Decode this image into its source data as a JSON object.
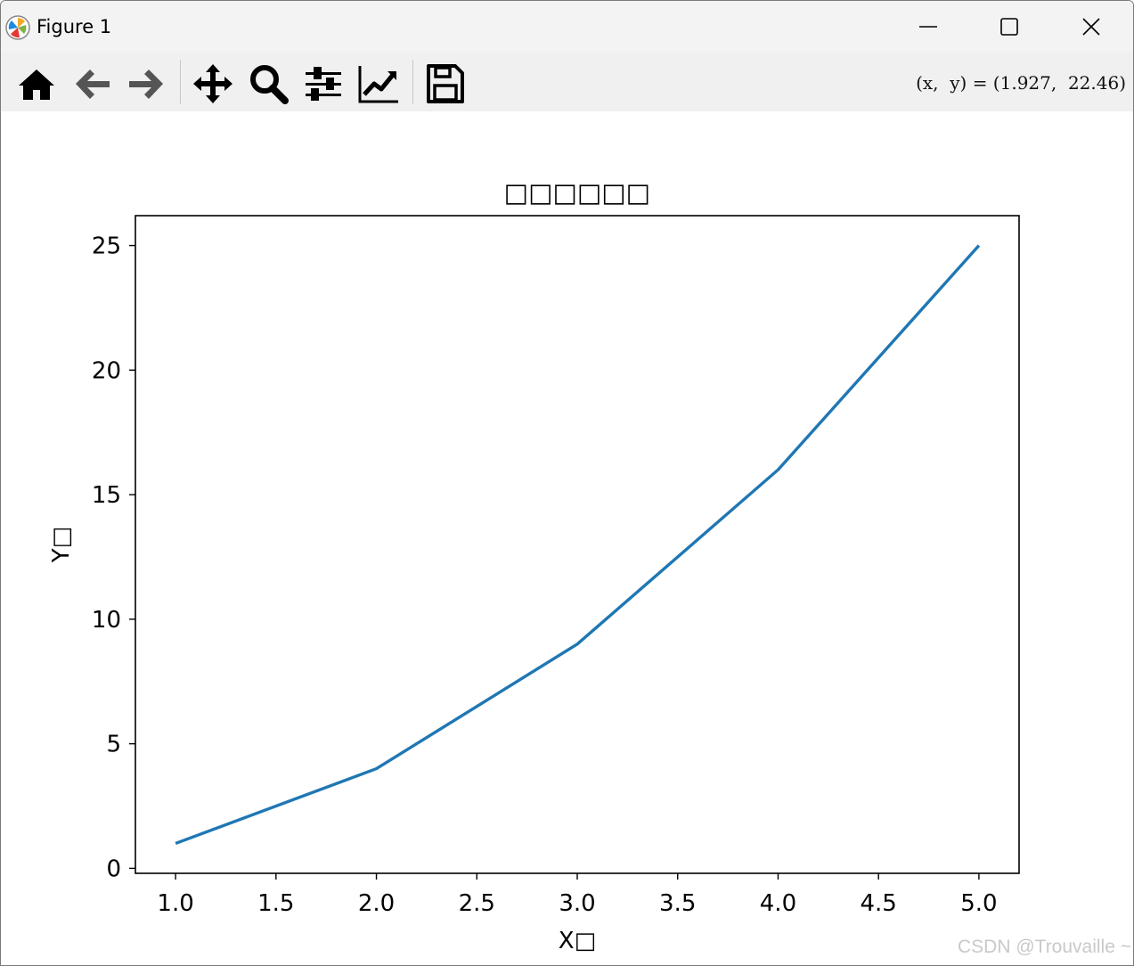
{
  "window": {
    "title": "Figure 1",
    "controls": {
      "minimize": "minimize",
      "maximize": "maximize",
      "close": "close"
    }
  },
  "toolbar": {
    "buttons": [
      {
        "id": "home",
        "icon": "home-icon",
        "label": "Home"
      },
      {
        "id": "back",
        "icon": "arrow-left-icon",
        "label": "Back"
      },
      {
        "id": "forward",
        "icon": "arrow-right-icon",
        "label": "Forward"
      },
      {
        "id": "pan",
        "icon": "move-icon",
        "label": "Pan"
      },
      {
        "id": "zoom",
        "icon": "magnifier-icon",
        "label": "Zoom"
      },
      {
        "id": "subplots",
        "icon": "sliders-icon",
        "label": "Subplots"
      },
      {
        "id": "customize",
        "icon": "line-chart-icon",
        "label": "Customize"
      },
      {
        "id": "save",
        "icon": "floppy-disk-icon",
        "label": "Save"
      }
    ],
    "coordinates": "(x,  y) = (1.927,  22.46)"
  },
  "chart_data": {
    "type": "line",
    "title": "□□□□□□",
    "xlabel": "X□",
    "ylabel": "Y□",
    "x": [
      1,
      2,
      3,
      4,
      5
    ],
    "series": [
      {
        "values": [
          1,
          4,
          9,
          16,
          25
        ],
        "color": "#1f77b4"
      }
    ],
    "xlim": [
      0.8,
      5.2
    ],
    "ylim": [
      -0.2,
      26.2
    ],
    "xticks": [
      1.0,
      1.5,
      2.0,
      2.5,
      3.0,
      3.5,
      4.0,
      4.5,
      5.0
    ],
    "xtick_labels": [
      "1.0",
      "1.5",
      "2.0",
      "2.5",
      "3.0",
      "3.5",
      "4.0",
      "4.5",
      "5.0"
    ],
    "yticks": [
      0,
      5,
      10,
      15,
      20,
      25
    ],
    "ytick_labels": [
      "0",
      "5",
      "10",
      "15",
      "20",
      "25"
    ],
    "grid": false,
    "legend": false
  },
  "watermark": "CSDN @Trouvaille ~"
}
